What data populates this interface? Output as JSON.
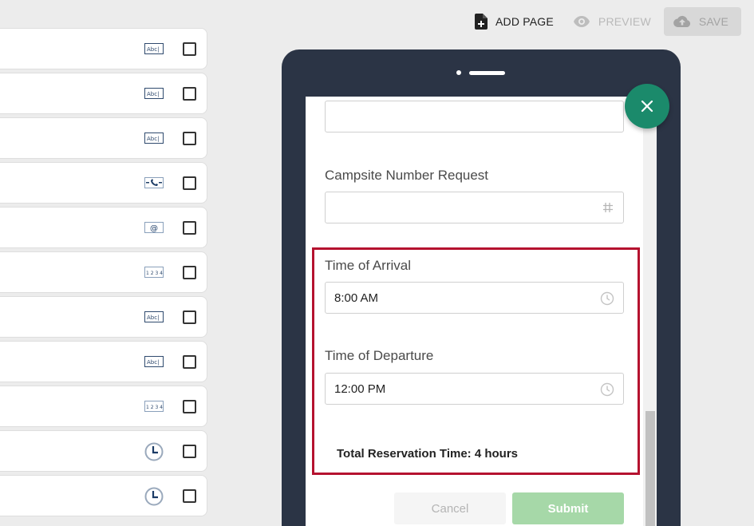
{
  "toolbar": {
    "add_page_label": "ADD PAGE",
    "preview_label": "PREVIEW",
    "save_label": "SAVE"
  },
  "field_list": {
    "rows": [
      {
        "icon": "text-field-icon",
        "checked": false
      },
      {
        "icon": "text-field-icon",
        "checked": false
      },
      {
        "icon": "text-field-icon",
        "checked": false
      },
      {
        "icon": "phone-field-icon",
        "checked": false
      },
      {
        "icon": "email-field-icon",
        "checked": false
      },
      {
        "icon": "number-field-icon",
        "checked": false
      },
      {
        "icon": "text-field-icon",
        "checked": false
      },
      {
        "icon": "text-field-icon",
        "checked": false
      },
      {
        "icon": "number-field-icon",
        "checked": false
      },
      {
        "icon": "clock-icon",
        "checked": false
      },
      {
        "icon": "clock-icon",
        "checked": false
      }
    ],
    "text_icon_glyph": "Abc|",
    "number_icon_glyph": "1 2 3 4",
    "email_icon_glyph": "@"
  },
  "form": {
    "campsite_label": "Campsite Number Request",
    "arrival_label": "Time of Arrival",
    "arrival_value": "8:00 AM",
    "departure_label": "Time of Departure",
    "departure_value": "12:00 PM",
    "total_text": "Total Reservation Time: 4 hours",
    "cancel_label": "Cancel",
    "submit_label": "Submit"
  },
  "colors": {
    "phone_frame": "#2b3445",
    "fab": "#1b8a6b",
    "highlight": "#b5122f",
    "submit": "#a6d8a8"
  }
}
